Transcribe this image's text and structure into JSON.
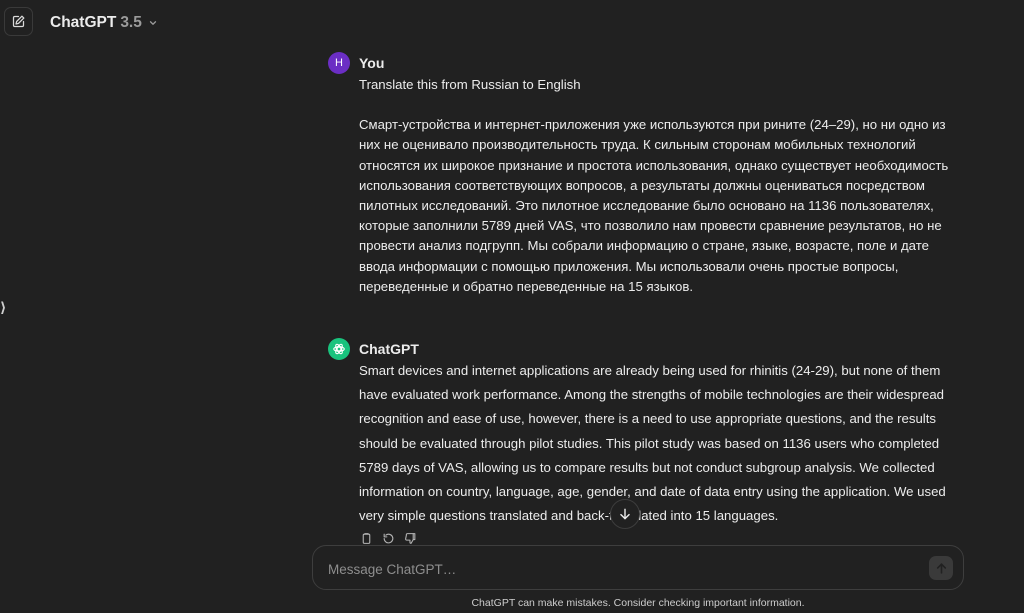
{
  "header": {
    "model_name": "ChatGPT",
    "model_version": "3.5",
    "new_chat_icon": "edit-icon"
  },
  "sidebar_toggle_glyph": "⟩",
  "messages": [
    {
      "author": "You",
      "avatar_letter": "H",
      "avatar_color": "#6b2ec4",
      "paragraphs": [
        "Translate this from Russian to English",
        "Смарт-устройства и интернет-приложения уже используются при рините (24–29), но ни одно из них не оценивало производительность труда. К сильным сторонам мобильных технологий относятся их широкое признание и простота использования, однако существует необходимость использования соответствующих вопросов, а результаты должны оцениваться посредством пилотных исследований. Это пилотное исследование было основано на 1136 пользователях, которые заполнили 5789 дней VAS, что позволило нам провести сравнение результатов, но не провести анализ подгрупп. Мы собрали информацию о стране, языке, возрасте, поле и дате ввода информации с помощью приложения. Мы использовали очень простые вопросы, переведенные и обратно переведенные на 15 языков."
      ]
    },
    {
      "author": "ChatGPT",
      "avatar_color": "#19c37d",
      "text": "Smart devices and internet applications are already being used for rhinitis (24-29), but none of them have evaluated work performance. Among the strengths of mobile technologies are their widespread recognition and ease of use, however, there is a need to use appropriate questions, and the results should be evaluated through pilot studies. This pilot study was based on 1136 users who completed 5789 days of VAS, allowing us to compare results but not conduct subgroup analysis. We collected information on country, language, age, gender, and date of data entry using the application. We used very simple questions translated and back-translated into 15 languages."
    }
  ],
  "message_actions": [
    "copy-icon",
    "regenerate-icon",
    "thumbs-down-icon"
  ],
  "composer": {
    "placeholder": "Message ChatGPT…"
  },
  "footer": {
    "disclaimer": "ChatGPT can make mistakes. Consider checking important information."
  }
}
